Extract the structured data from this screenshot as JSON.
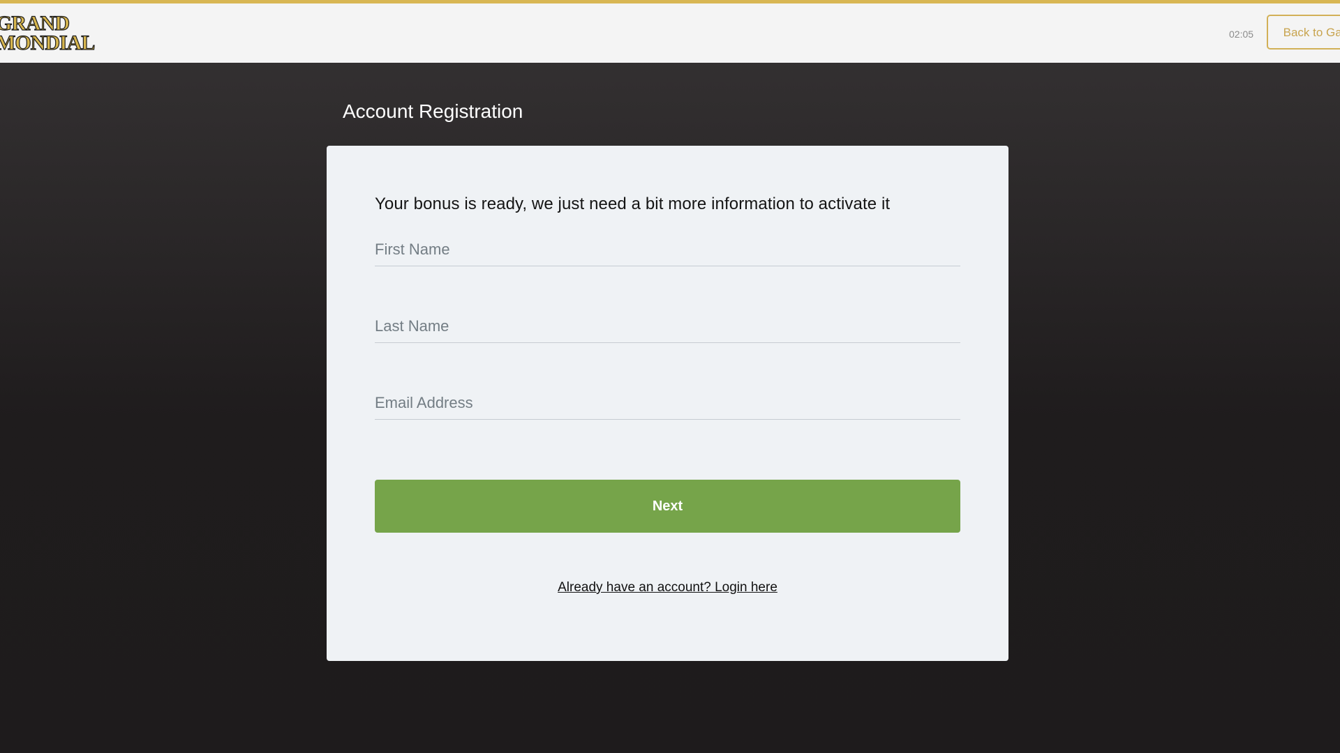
{
  "header": {
    "logo_line1": "GRAND",
    "logo_line2": "MONDIAL",
    "timer": "02:05",
    "back_button_label": "Back to Game"
  },
  "page": {
    "title": "Account Registration"
  },
  "form": {
    "headline": "Your bonus is ready, we just need a bit more information to activate it",
    "first_name": {
      "placeholder": "First Name",
      "value": ""
    },
    "last_name": {
      "placeholder": "Last Name",
      "value": ""
    },
    "email": {
      "placeholder": "Email Address",
      "value": ""
    },
    "next_label": "Next",
    "login_link": "Already have an account? Login here"
  },
  "colors": {
    "accent_gold": "#d8b653",
    "next_green": "#76a44a",
    "card_bg": "#eff2f5",
    "header_bg": "#f4f4f4"
  }
}
